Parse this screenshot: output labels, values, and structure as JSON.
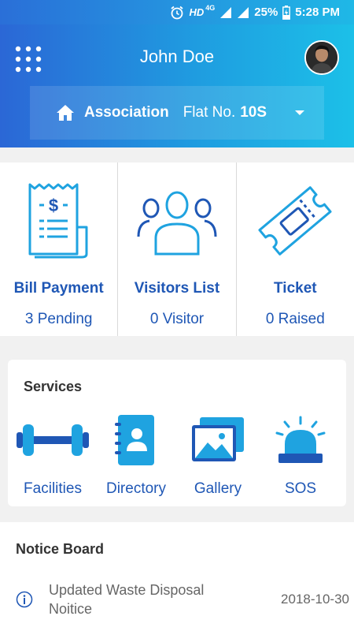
{
  "status_bar": {
    "hd": "HD",
    "network": "4G",
    "battery": "25%",
    "time": "5:28 PM"
  },
  "header": {
    "user_name": "John Doe",
    "association_label": "Association",
    "flat_label": "Flat No.",
    "flat_value": "10S"
  },
  "summary": [
    {
      "title": "Bill Payment",
      "subtitle": "3 Pending",
      "icon": "bill-receipt-icon"
    },
    {
      "title": "Visitors List",
      "subtitle": "0 Visitor",
      "icon": "visitors-group-icon"
    },
    {
      "title": "Ticket",
      "subtitle": "0 Raised",
      "icon": "ticket-icon"
    }
  ],
  "services": {
    "title": "Services",
    "items": [
      {
        "label": "Facilities",
        "icon": "dumbbell-icon"
      },
      {
        "label": "Directory",
        "icon": "contact-book-icon"
      },
      {
        "label": "Gallery",
        "icon": "gallery-icon"
      },
      {
        "label": "SOS",
        "icon": "siren-icon"
      }
    ]
  },
  "notice_board": {
    "title": "Notice Board",
    "items": [
      {
        "text": "Updated Waste Disposal Noitice",
        "date": "2018-10-30"
      }
    ]
  },
  "colors": {
    "header_start": "#2b67d6",
    "header_end": "#1cc0e8",
    "accent_text": "#1f57b5",
    "icon_blue": "#1fa3e0"
  }
}
